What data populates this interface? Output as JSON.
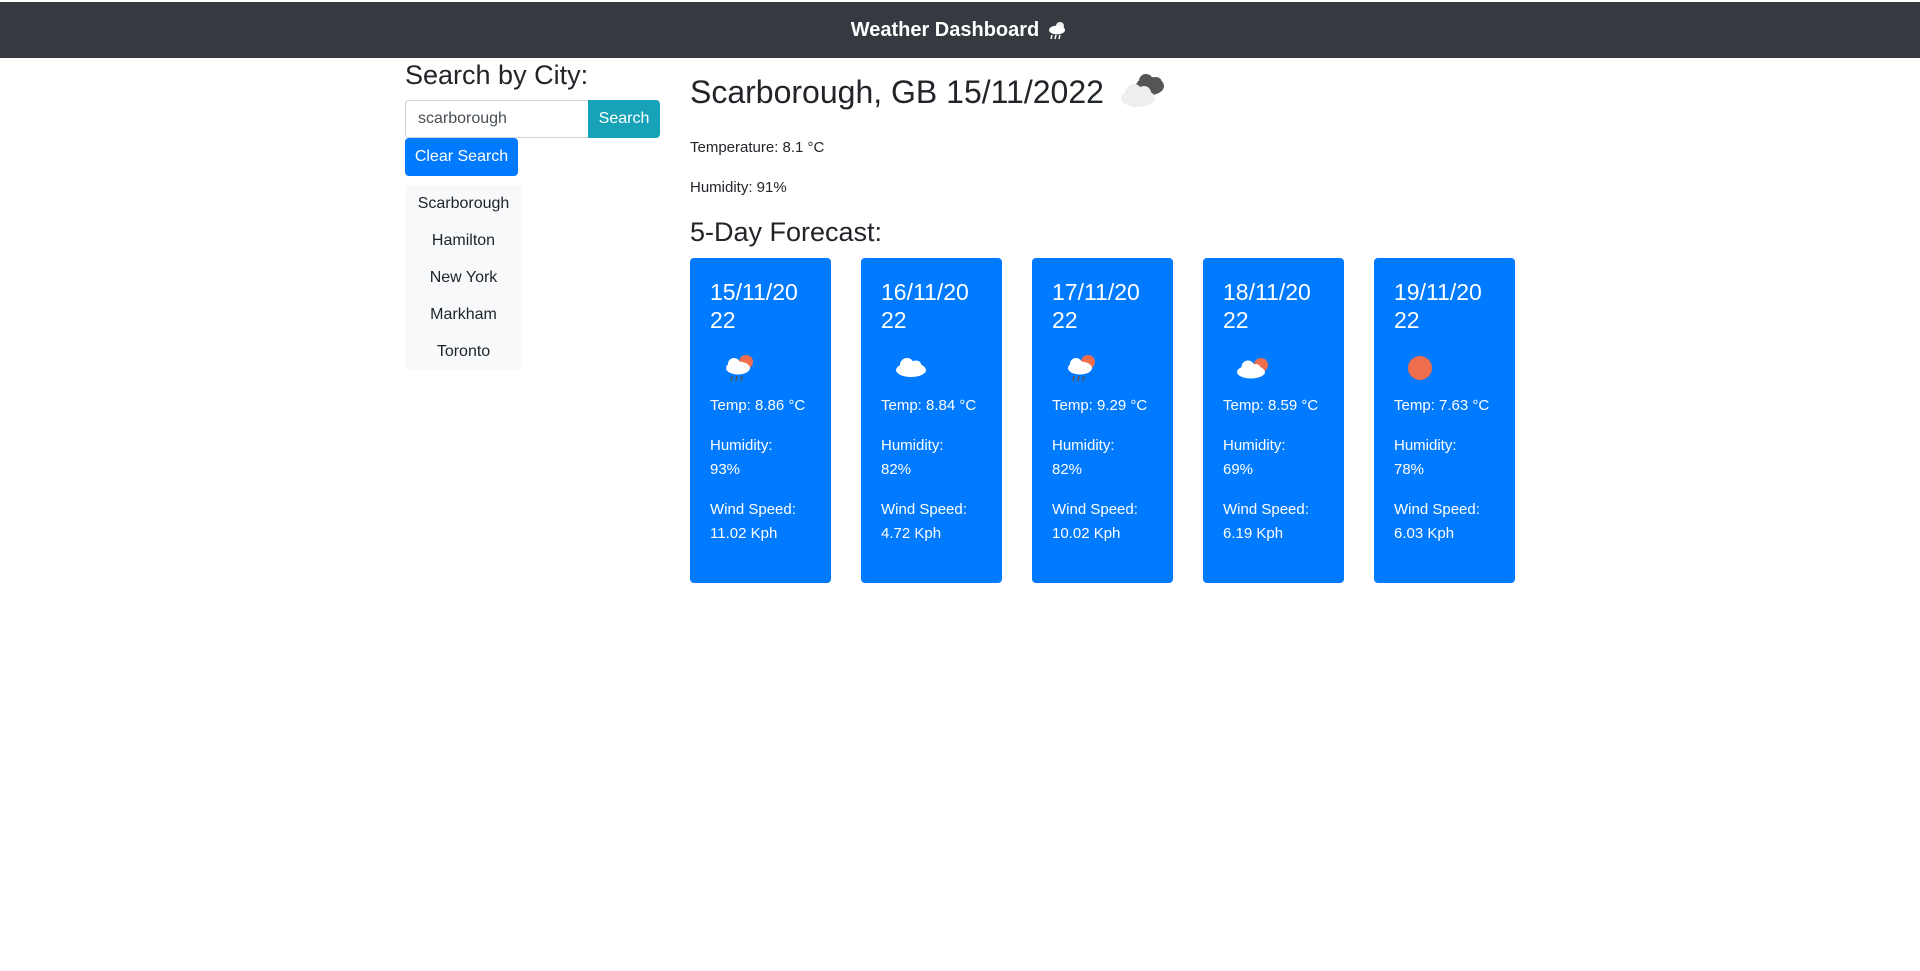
{
  "header": {
    "title": "Weather Dashboard",
    "icon": "cloud-sun-rain-icon"
  },
  "search": {
    "heading": "Search by City:",
    "input_value": "scarborough",
    "search_label": "Search",
    "clear_label": "Clear Search"
  },
  "history": [
    "Scarborough",
    "Hamilton",
    "New York",
    "Markham",
    "Toronto"
  ],
  "current": {
    "heading": "Scarborough, GB 15/11/2022",
    "icon": "broken-clouds-icon",
    "temperature": "Temperature: 8.1 °C",
    "humidity": "Humidity: 91%"
  },
  "forecast": {
    "heading": "5-Day Forecast:",
    "days": [
      {
        "date": "15/11/2022",
        "icon": "rain-sun-icon",
        "temp": "Temp: 8.86 °C",
        "humidity_label": "Humidity:",
        "humidity": "93%",
        "wind_label": "Wind Speed:",
        "wind": "11.02 Kph"
      },
      {
        "date": "16/11/2022",
        "icon": "cloud-icon",
        "temp": "Temp: 8.84 °C",
        "humidity_label": "Humidity:",
        "humidity": "82%",
        "wind_label": "Wind Speed:",
        "wind": "4.72 Kph"
      },
      {
        "date": "17/11/2022",
        "icon": "rain-sun-icon",
        "temp": "Temp: 9.29 °C",
        "humidity_label": "Humidity:",
        "humidity": "82%",
        "wind_label": "Wind Speed:",
        "wind": "10.02 Kph"
      },
      {
        "date": "18/11/2022",
        "icon": "cloud-sun-icon",
        "temp": "Temp: 8.59 °C",
        "humidity_label": "Humidity:",
        "humidity": "69%",
        "wind_label": "Wind Speed:",
        "wind": "6.19 Kph"
      },
      {
        "date": "19/11/2022",
        "icon": "sun-icon",
        "temp": "Temp: 7.63 °C",
        "humidity_label": "Humidity:",
        "humidity": "78%",
        "wind_label": "Wind Speed:",
        "wind": "6.03 Kph"
      }
    ]
  },
  "colors": {
    "navbar": "#343a40",
    "primary": "#007bff",
    "info": "#17a2b8",
    "sun": "#ee6e4e"
  }
}
